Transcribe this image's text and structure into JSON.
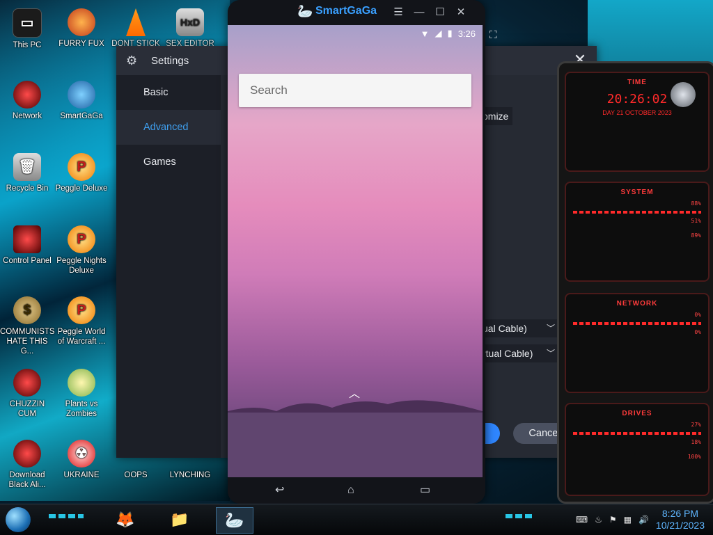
{
  "desktop": {
    "icons": [
      {
        "label": "This PC"
      },
      {
        "label": "FURRY FUX"
      },
      {
        "label": "DONT STICK"
      },
      {
        "label": "SEX EDITOR"
      },
      {
        "label": "Network"
      },
      {
        "label": "SmartGaGa"
      },
      {
        "label": "Recycle Bin"
      },
      {
        "label": "Peggle Deluxe"
      },
      {
        "label": "Control Panel"
      },
      {
        "label": "Peggle Nights Deluxe"
      },
      {
        "label": "COMMUNISTS HATE THIS G..."
      },
      {
        "label": "Peggle World of Warcraft ..."
      },
      {
        "label": "CHUZZIN CUM"
      },
      {
        "label": "Plants vs Zombies"
      },
      {
        "label": "Download Black Ali..."
      },
      {
        "label": "UKRAINE"
      },
      {
        "label": "OOPS"
      },
      {
        "label": "LYNCHING"
      }
    ]
  },
  "settings": {
    "title": "Settings",
    "nav": [
      {
        "label": "Basic"
      },
      {
        "label": "Advanced"
      },
      {
        "label": "Games"
      }
    ],
    "active_nav": "Advanced",
    "customize_fragment": "omize",
    "select1": "ual Cable)",
    "select2": "rtual Cable)",
    "cancel_label": "Cancel"
  },
  "emulator": {
    "brand": "SmartGaGa",
    "time": "3:26",
    "search_placeholder": "Search"
  },
  "widget": {
    "time_title": "TIME",
    "clock": "20:26:02",
    "date": "DAY 21 OCTOBER 2023",
    "system_title": "SYSTEM",
    "system_values": [
      "88%",
      "51%",
      "89%"
    ],
    "network_title": "NETWORK",
    "network_values": [
      "0%",
      "0%"
    ],
    "drives_title": "DRIVES",
    "drives_values": [
      "27%",
      "18%",
      "100%"
    ]
  },
  "taskbar": {
    "time": "8:26 PM",
    "date": "10/21/2023"
  },
  "colors": {
    "accent": "#3fa0f0",
    "brand": "#3aa0ff",
    "widget_red": "#ff2a2a"
  }
}
